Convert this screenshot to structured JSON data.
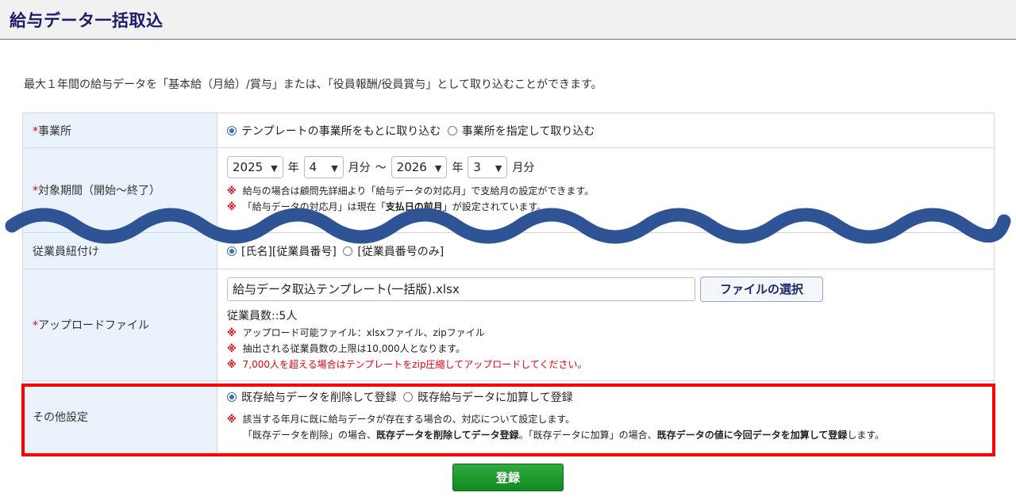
{
  "header": {
    "title": "給与データ一括取込"
  },
  "description": "最大１年間の給与データを「基本給（月給）/賞与」または、「役員報酬/役員賞与」として取り込むことができます。",
  "rows": {
    "office": {
      "label": "事業所",
      "required": "*",
      "options": [
        {
          "label": "テンプレートの事業所をもとに取り込む",
          "selected": true
        },
        {
          "label": "事業所を指定して取り込む",
          "selected": false
        }
      ]
    },
    "period": {
      "label": "対象期間（開始～終了）",
      "required": "*",
      "start_year": "2025",
      "start_month": "4",
      "end_year": "2026",
      "end_month": "3",
      "year_unit": "年",
      "month_unit": "月分",
      "tilde": "～",
      "note1": "給与の場合は顧問先詳細より「給与データの対応月」で支給月の設定ができます。",
      "note2_prefix": "「給与データの対応月」は現在「",
      "note2_bold": "支払日の前月",
      "note2_suffix": "」が設定されています。"
    },
    "employee_link": {
      "label": "従業員紐付け",
      "options": [
        {
          "label": "[氏名][従業員番号]",
          "selected": true
        },
        {
          "label": "[従業員番号のみ]",
          "selected": false
        }
      ]
    },
    "upload": {
      "label": "アップロードファイル",
      "required": "*",
      "file_name": "給与データ取込テンプレート(一括版).xlsx",
      "choose_button": "ファイルの選択",
      "employee_count": "従業員数::5人",
      "note1": "アップロード可能ファイル：xlsxファイル、zipファイル",
      "note2": "抽出される従業員数の上限は10,000人となります。",
      "note3": "7,000人を超える場合はテンプレートをzip圧縮してアップロードしてください。"
    },
    "other": {
      "label": "その他設定",
      "options": [
        {
          "label": "既存給与データを削除して登録",
          "selected": true
        },
        {
          "label": "既存給与データに加算して登録",
          "selected": false
        }
      ],
      "note1": "該当する年月に既に給与データが存在する場合の、対応について設定します。",
      "note2_a": "「既存データを削除」の場合、",
      "note2_b": "既存データを削除してデータ登録",
      "note2_c": "。「既存データに加算」の場合、",
      "note2_d": "既存データの値に今回データを加算して登録",
      "note2_e": "します。"
    }
  },
  "note_mark": "※",
  "submit_label": "登録",
  "colors": {
    "accent": "#1a1a6e",
    "required": "#e60012",
    "highlight": "#ff0000",
    "submit": "#1f9a30",
    "wave": "#2f5496"
  }
}
